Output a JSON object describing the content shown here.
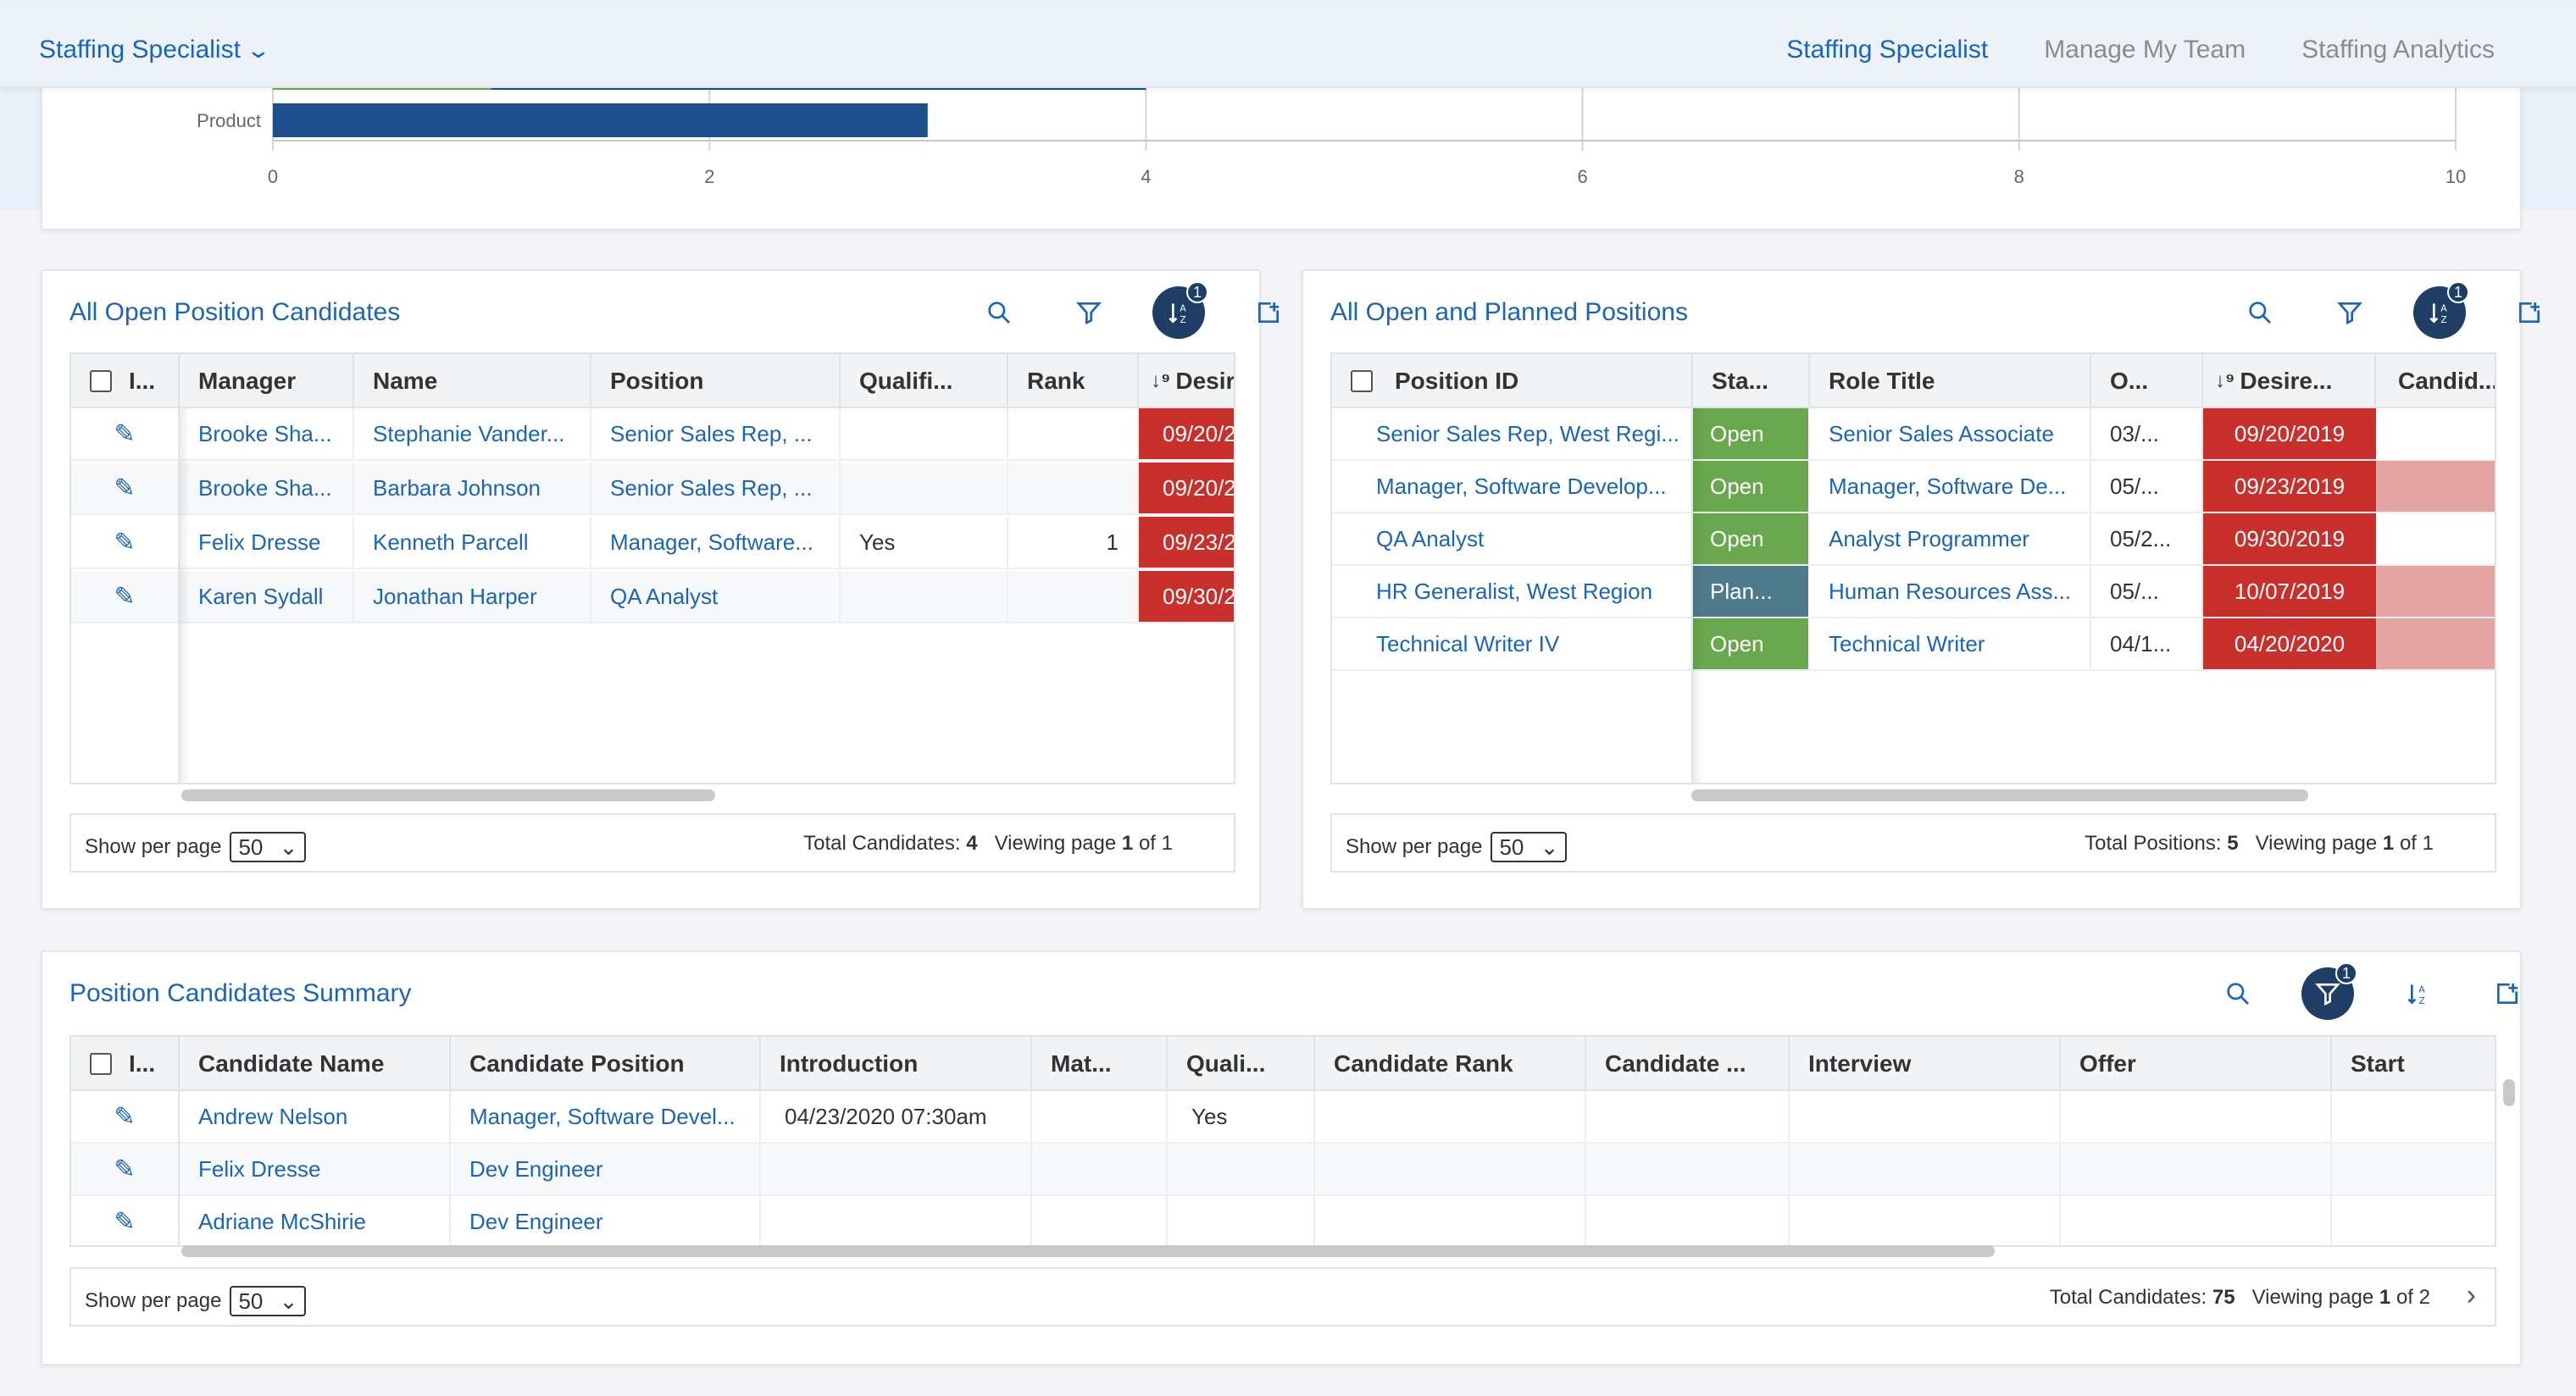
{
  "header": {
    "app_switcher": "Staffing Specialist",
    "nav": [
      {
        "label": "Staffing Specialist",
        "active": true
      },
      {
        "label": "Manage My Team",
        "active": false
      },
      {
        "label": "Staffing Analytics",
        "active": false
      }
    ]
  },
  "colors": {
    "accent": "#1a65b5",
    "bar_blue": "#1f4e8c",
    "bar_green": "#6aa84f",
    "overdue_red": "#c9302c",
    "pink": "#e4a4a2",
    "open_green": "#6aa84f",
    "planned_slate": "#4f7a8c"
  },
  "chart_data": {
    "type": "bar",
    "orientation": "horizontal",
    "categories": [
      "Product"
    ],
    "partial_bar_above": {
      "segments": [
        {
          "color": "#6aa84f",
          "value": 1
        },
        {
          "color": "#1f4e8c",
          "value": 3
        }
      ]
    },
    "values": [
      3
    ],
    "xlim": [
      0,
      10
    ],
    "xticks": [
      "0",
      "2",
      "4",
      "6",
      "8",
      "10"
    ],
    "grid": true
  },
  "panel1": {
    "title": "All Open Position Candidates",
    "sort_badge": "1",
    "headers": [
      "I...",
      "Manager",
      "Name",
      "Position",
      "Qualifi...",
      "Rank",
      "Desire"
    ],
    "rows": [
      {
        "manager": "Brooke Sha...",
        "name": "Stephanie Vander...",
        "position": "Senior Sales Rep, ...",
        "qualified": "",
        "rank": "",
        "desired": "09/20/2"
      },
      {
        "manager": "Brooke Sha...",
        "name": "Barbara Johnson",
        "position": "Senior Sales Rep, ...",
        "qualified": "",
        "rank": "",
        "desired": "09/20/2"
      },
      {
        "manager": "Felix Dresse",
        "name": "Kenneth Parcell",
        "position": "Manager, Software...",
        "qualified": "Yes",
        "rank": "1",
        "desired": "09/23/2"
      },
      {
        "manager": "Karen Sydall",
        "name": "Jonathan Harper",
        "position": "QA Analyst",
        "qualified": "",
        "rank": "",
        "desired": "09/30/2"
      }
    ],
    "show_per_page_label": "Show per page",
    "per_page": "50",
    "total_label": "Total Candidates:",
    "total": "4",
    "viewing_label": "Viewing page",
    "page": "1",
    "of_label": "of",
    "pages": "1"
  },
  "panel2": {
    "title": "All Open and Planned Positions",
    "sort_badge": "1",
    "headers": [
      "Position ID",
      "Sta...",
      "Role Title",
      "O...",
      "Desire...",
      "Candid..."
    ],
    "rows": [
      {
        "position_id": "Senior Sales Rep, West Regi...",
        "status": "Open",
        "status_kind": "open",
        "role": "Senior Sales Associate",
        "opened": "03/...",
        "desired": "09/20/2019",
        "candid_pink": false
      },
      {
        "position_id": "Manager, Software Develop...",
        "status": "Open",
        "status_kind": "open",
        "role": "Manager, Software De...",
        "opened": "05/...",
        "desired": "09/23/2019",
        "candid_pink": true
      },
      {
        "position_id": "QA Analyst",
        "status": "Open",
        "status_kind": "open",
        "role": "Analyst Programmer",
        "opened": "05/2...",
        "desired": "09/30/2019",
        "candid_pink": false
      },
      {
        "position_id": "HR Generalist, West Region",
        "status": "Plan...",
        "status_kind": "planned",
        "role": "Human Resources Ass...",
        "opened": "05/...",
        "desired": "10/07/2019",
        "candid_pink": true
      },
      {
        "position_id": "Technical Writer IV",
        "status": "Open",
        "status_kind": "open",
        "role": "Technical Writer",
        "opened": "04/1...",
        "desired": "04/20/2020",
        "candid_pink": true
      }
    ],
    "show_per_page_label": "Show per page",
    "per_page": "50",
    "total_label": "Total Positions:",
    "total": "5",
    "viewing_label": "Viewing page",
    "page": "1",
    "of_label": "of",
    "pages": "1"
  },
  "panel3": {
    "title": "Position Candidates Summary",
    "filter_badge": "1",
    "headers": [
      "I...",
      "Candidate Name",
      "Candidate Position",
      "Introduction",
      "Mat...",
      "Quali...",
      "Candidate Rank",
      "Candidate ...",
      "Interview",
      "Offer",
      "Start"
    ],
    "rows": [
      {
        "name": "Andrew Nelson",
        "position": "Manager, Software Devel...",
        "introduction": "04/23/2020 07:30am",
        "qualified": "Yes"
      },
      {
        "name": "Felix Dresse",
        "position": "Dev Engineer",
        "introduction": "",
        "qualified": ""
      },
      {
        "name": "Adriane McShirie",
        "position": "Dev Engineer",
        "introduction": "",
        "qualified": ""
      }
    ],
    "show_per_page_label": "Show per page",
    "per_page": "50",
    "total_label": "Total Candidates:",
    "total": "75",
    "viewing_label": "Viewing page",
    "page": "1",
    "of_label": "of",
    "pages": "2"
  }
}
